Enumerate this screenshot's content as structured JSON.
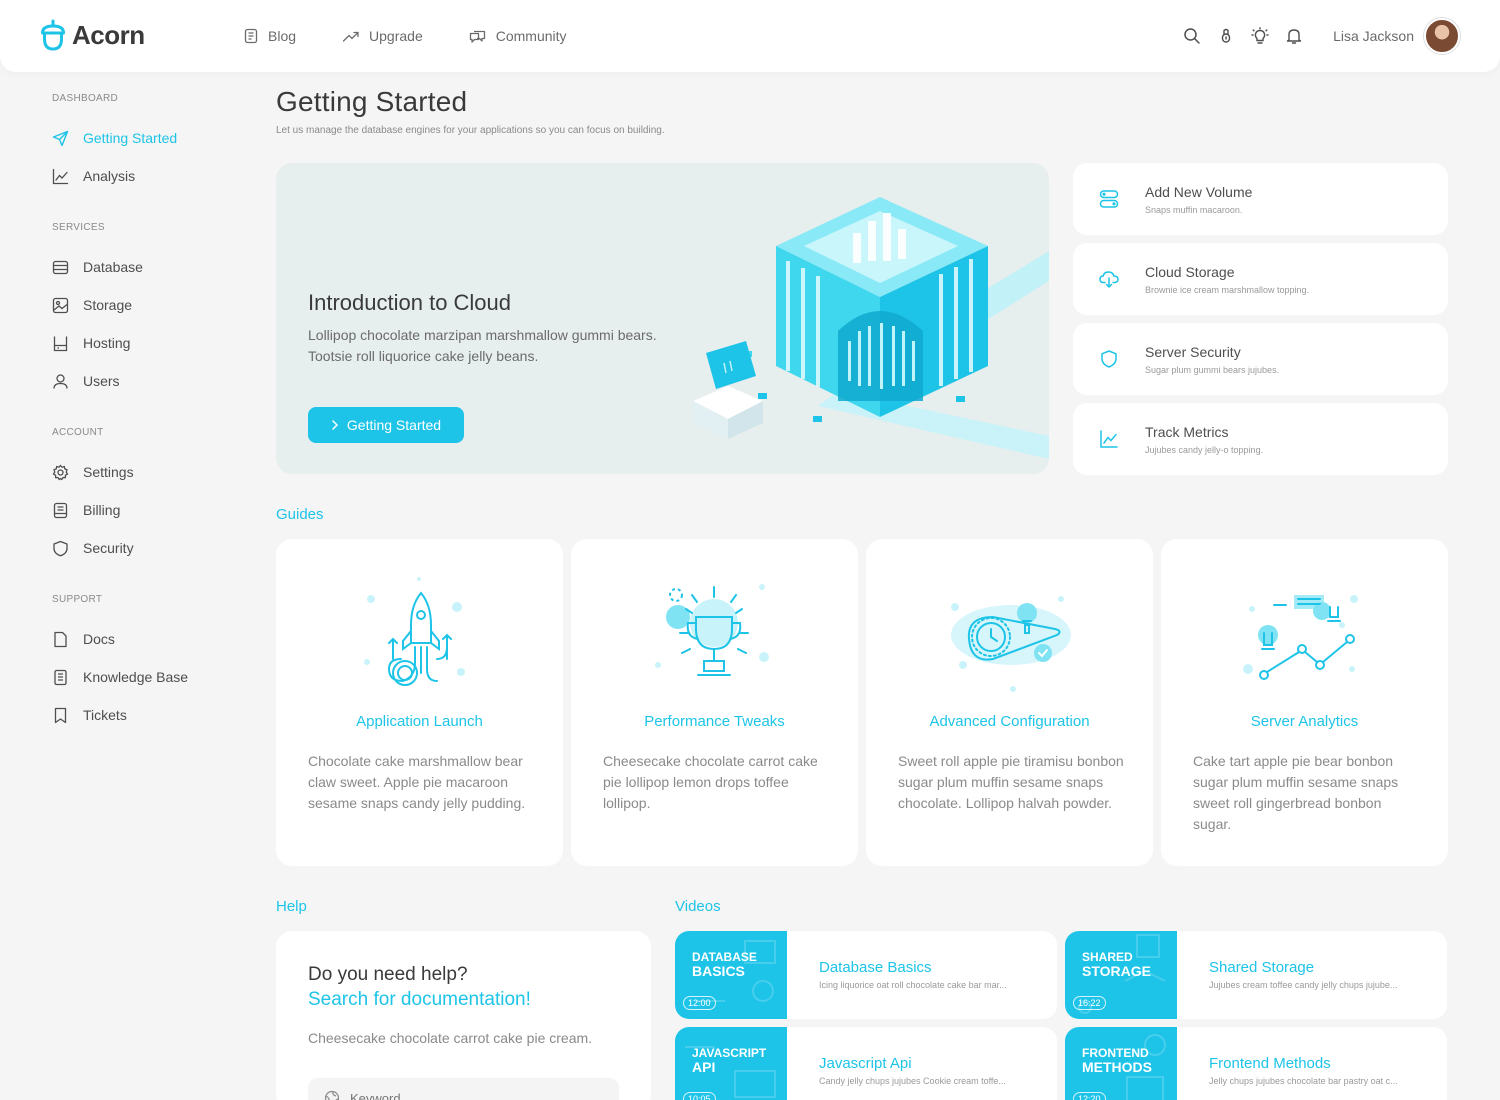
{
  "app": {
    "name": "Acorn"
  },
  "topnav": [
    {
      "label": "Blog",
      "icon": "document-icon"
    },
    {
      "label": "Upgrade",
      "icon": "trend-up-icon"
    },
    {
      "label": "Community",
      "icon": "chat-icon"
    }
  ],
  "user": {
    "name": "Lisa Jackson"
  },
  "sidebar": {
    "dashboard": {
      "heading": "DASHBOARD",
      "items": [
        {
          "label": "Getting Started",
          "active": true
        },
        {
          "label": "Analysis"
        }
      ]
    },
    "services": {
      "heading": "SERVICES",
      "items": [
        {
          "label": "Database"
        },
        {
          "label": "Storage"
        },
        {
          "label": "Hosting"
        },
        {
          "label": "Users"
        }
      ]
    },
    "account": {
      "heading": "ACCOUNT",
      "items": [
        {
          "label": "Settings"
        },
        {
          "label": "Billing"
        },
        {
          "label": "Security"
        }
      ]
    },
    "support": {
      "heading": "SUPPORT",
      "items": [
        {
          "label": "Docs"
        },
        {
          "label": "Knowledge Base"
        },
        {
          "label": "Tickets"
        }
      ]
    }
  },
  "page": {
    "title": "Getting Started",
    "subtitle": "Let us manage the database engines for your applications so you can focus on building."
  },
  "hero": {
    "title": "Introduction to Cloud",
    "text": "Lollipop chocolate marzipan marshmallow gummi bears. Tootsie roll liquorice cake jelly beans.",
    "button": "Getting Started"
  },
  "quick": [
    {
      "title": "Add New Volume",
      "sub": "Snaps muffin macaroon.",
      "icon": "volume-icon"
    },
    {
      "title": "Cloud Storage",
      "sub": "Brownie ice cream marshmallow topping.",
      "icon": "cloud-icon"
    },
    {
      "title": "Server Security",
      "sub": "Sugar plum gummi bears jujubes.",
      "icon": "shield-icon"
    },
    {
      "title": "Track Metrics",
      "sub": "Jujubes candy jelly-o topping.",
      "icon": "chart-icon"
    }
  ],
  "guides": {
    "title": "Guides",
    "items": [
      {
        "title": "Application Launch",
        "text": "Chocolate cake marshmallow bear claw sweet. Apple pie macaroon sesame snaps candy jelly pudding."
      },
      {
        "title": "Performance Tweaks",
        "text": "Cheesecake chocolate carrot cake pie lollipop lemon drops toffee lollipop."
      },
      {
        "title": "Advanced Configuration",
        "text": "Sweet roll apple pie tiramisu bonbon sugar plum muffin sesame snaps chocolate. Lollipop halvah powder."
      },
      {
        "title": "Server Analytics",
        "text": "Cake tart apple pie bear bonbon sugar plum muffin sesame snaps sweet roll gingerbread bonbon sugar."
      }
    ]
  },
  "help": {
    "title": "Help",
    "question": "Do you need help?",
    "link": "Search for documentation!",
    "text": "Cheesecake chocolate carrot cake pie cream.",
    "search_placeholder": "Keyword"
  },
  "videos": {
    "title": "Videos",
    "items": [
      {
        "thumb_line1": "DATABASE",
        "thumb_line2": "BASICS",
        "duration": "12:00",
        "title": "Database Basics",
        "sub": "Icing liquorice oat roll chocolate cake bar mar..."
      },
      {
        "thumb_line1": "SHARED",
        "thumb_line2": "STORAGE",
        "duration": "16:22",
        "title": "Shared Storage",
        "sub": "Jujubes cream toffee candy jelly chups jujube..."
      },
      {
        "thumb_line1": "JAVASCRIPT",
        "thumb_line2": "API",
        "duration": "10:05",
        "title": "Javascript Api",
        "sub": "Candy jelly chups jujubes Cookie cream toffe..."
      },
      {
        "thumb_line1": "FRONTEND",
        "thumb_line2": "METHODS",
        "duration": "12:20",
        "title": "Frontend Methods",
        "sub": "Jelly chups jujubes chocolate bar pastry oat c..."
      }
    ]
  },
  "colors": {
    "accent": "#1ec4e8",
    "background": "#f5f5f5",
    "card": "#ffffff",
    "hero": "#e7eeee"
  }
}
